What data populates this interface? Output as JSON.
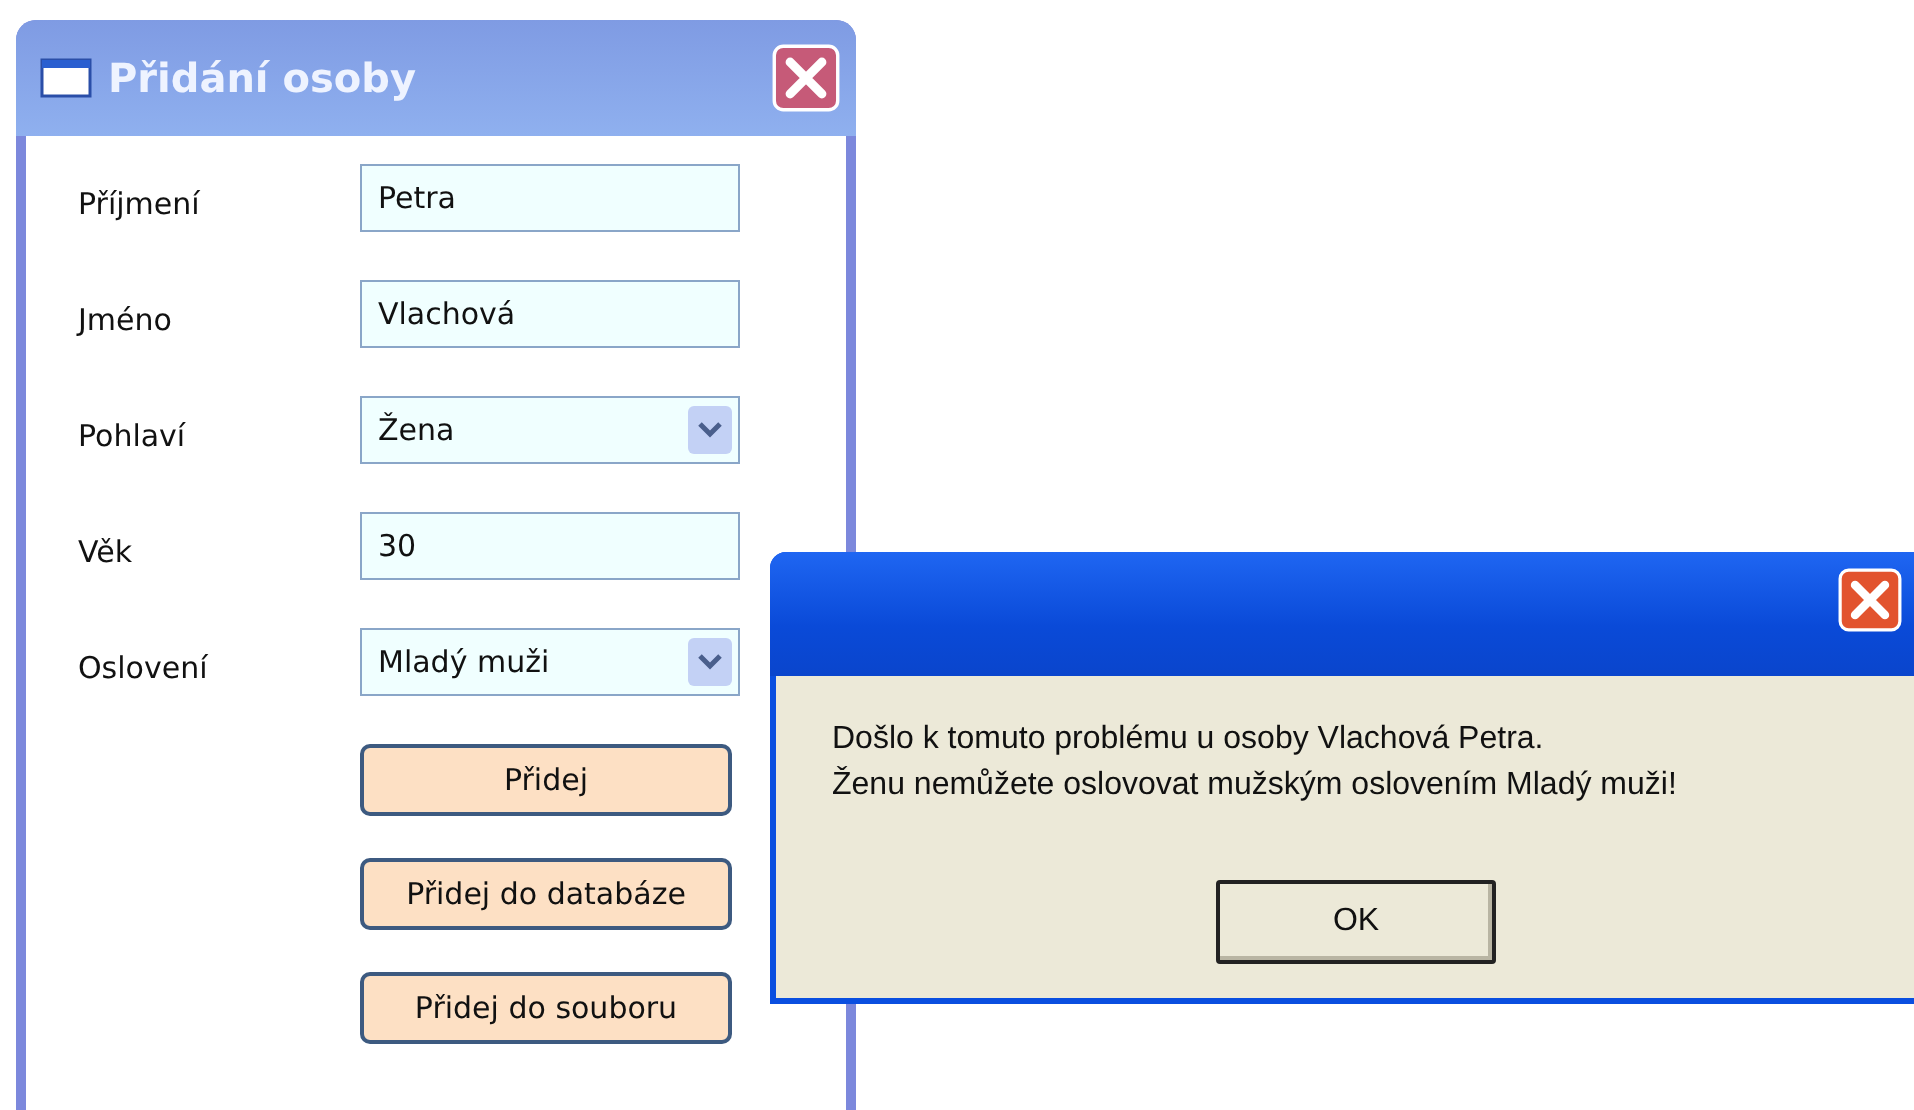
{
  "main_window": {
    "title": "Přidání osoby",
    "fields": [
      {
        "label": "Příjmení",
        "kind": "text",
        "value": "Petra"
      },
      {
        "label": "Jméno",
        "kind": "text",
        "value": "Vlachová"
      },
      {
        "label": "Pohlaví",
        "kind": "select",
        "value": "Žena"
      },
      {
        "label": "Věk",
        "kind": "text",
        "value": "30"
      },
      {
        "label": "Oslovení",
        "kind": "select",
        "value": "Mladý muži"
      }
    ],
    "buttons": [
      "Přidej",
      "Přidej do databáze",
      "Přidej do souboru"
    ]
  },
  "message_box": {
    "lines": [
      "Došlo k tomuto problému u osoby Vlachová Petra.",
      "Ženu nemůžete oslovovat mužským oslovením Mladý muži!"
    ],
    "button": "OK"
  }
}
